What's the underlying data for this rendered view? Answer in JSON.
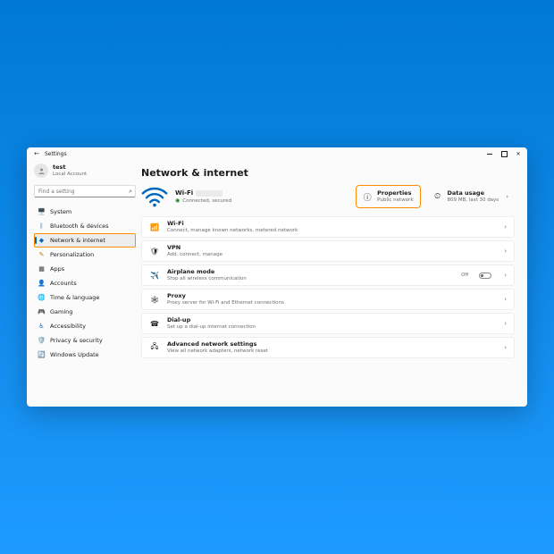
{
  "titlebar": {
    "back_glyph": "←",
    "title": "Settings"
  },
  "account": {
    "name": "test",
    "subtitle": "Local Account"
  },
  "search": {
    "placeholder": "Find a setting",
    "icon_glyph": "⌕"
  },
  "sidebar": {
    "items": [
      {
        "label": "System",
        "icon": "🖥️",
        "color": "#3b3b3b"
      },
      {
        "label": "Bluetooth & devices",
        "icon": "ᛒ",
        "color": "#0067c0"
      },
      {
        "label": "Network & internet",
        "icon": "◆",
        "color": "#0067c0"
      },
      {
        "label": "Personalization",
        "icon": "✎",
        "color": "#c27c0e"
      },
      {
        "label": "Apps",
        "icon": "▦",
        "color": "#3b3b3b"
      },
      {
        "label": "Accounts",
        "icon": "👤",
        "color": "#0067c0"
      },
      {
        "label": "Time & language",
        "icon": "🌐",
        "color": "#3b3b3b"
      },
      {
        "label": "Gaming",
        "icon": "🎮",
        "color": "#3b3b3b"
      },
      {
        "label": "Accessibility",
        "icon": "♿",
        "color": "#0067c0"
      },
      {
        "label": "Privacy & security",
        "icon": "🛡️",
        "color": "#0067c0"
      },
      {
        "label": "Windows Update",
        "icon": "🔄",
        "color": "#0067c0"
      }
    ],
    "active_index": 2
  },
  "page": {
    "heading": "Network & internet",
    "hero": {
      "ssid_label": "Wi-Fi",
      "status": "Connected, secured",
      "status_glyph": "◉",
      "properties": {
        "title": "Properties",
        "subtitle": "Public network",
        "icon": "ⓘ"
      },
      "data_usage": {
        "title": "Data usage",
        "subtitle": "809 MB, last 30 days",
        "icon": "⏲"
      },
      "chevron": "›"
    },
    "rows": [
      {
        "icon": "📶",
        "title": "Wi-Fi",
        "subtitle": "Connect, manage known networks, metered network"
      },
      {
        "icon": "🛡",
        "title": "VPN",
        "subtitle": "Add, connect, manage"
      },
      {
        "icon": "✈️",
        "title": "Airplane mode",
        "subtitle": "Stop all wireless communication",
        "state": "Off",
        "toggle": true
      },
      {
        "icon": "🕸",
        "title": "Proxy",
        "subtitle": "Proxy server for Wi-Fi and Ethernet connections"
      },
      {
        "icon": "☎",
        "title": "Dial-up",
        "subtitle": "Set up a dial-up internet connection"
      },
      {
        "icon": "🖧",
        "title": "Advanced network settings",
        "subtitle": "View all network adapters, network reset"
      }
    ],
    "chevron": "›"
  }
}
